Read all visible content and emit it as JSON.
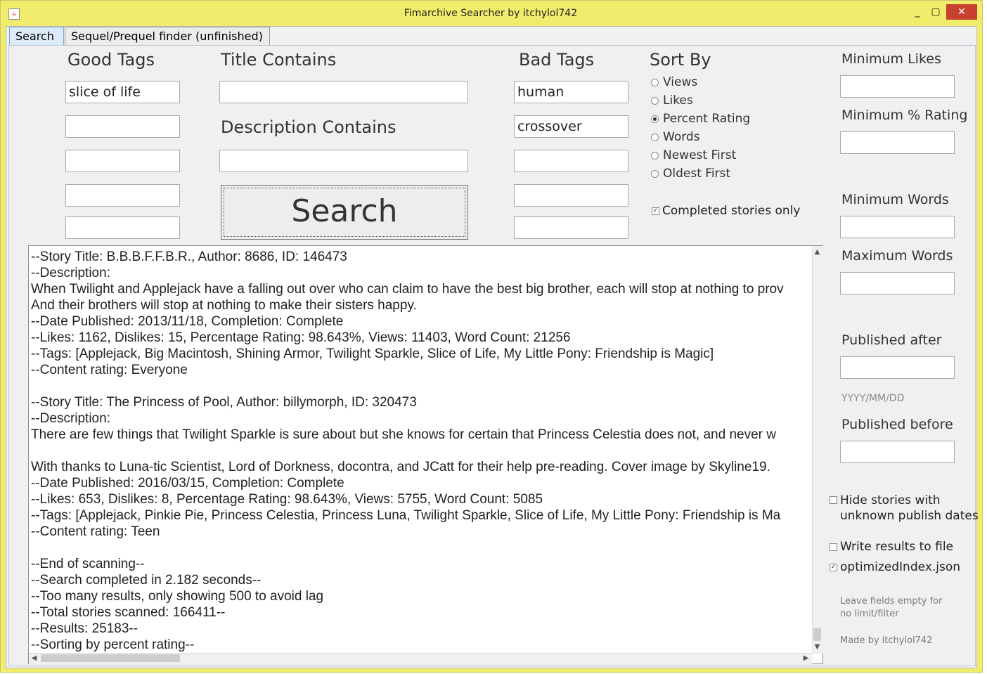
{
  "window": {
    "title": "Fimarchive Searcher by itchylol742",
    "minimize": "_",
    "maximize": "▢",
    "close": "✕"
  },
  "tabs": [
    {
      "label": "Search",
      "active": true
    },
    {
      "label": "Sequel/Prequel finder (unfinished)",
      "active": false
    }
  ],
  "good_tags": {
    "header": "Good Tags",
    "values": [
      "slice of life",
      "",
      "",
      "",
      ""
    ]
  },
  "title_contains": {
    "header": "Title Contains",
    "value": ""
  },
  "description_contains": {
    "header": "Description Contains",
    "value": ""
  },
  "search_button": "Search",
  "bad_tags": {
    "header": "Bad Tags",
    "values": [
      "human",
      "crossover",
      "",
      "",
      ""
    ]
  },
  "sort_by": {
    "header": "Sort By",
    "options": [
      "Views",
      "Likes",
      "Percent Rating",
      "Words",
      "Newest First",
      "Oldest First"
    ],
    "selected": "Percent Rating"
  },
  "completed_only": {
    "label": "Completed stories only",
    "checked": true
  },
  "filters": {
    "min_likes": {
      "label": "Minimum Likes",
      "value": ""
    },
    "min_rating": {
      "label": "Minimum % Rating",
      "value": ""
    },
    "min_words": {
      "label": "Minimum Words",
      "value": ""
    },
    "max_words": {
      "label": "Maximum Words",
      "value": ""
    },
    "published_after": {
      "label": "Published after",
      "value": ""
    },
    "date_format_hint": "YYYY/MM/DD",
    "published_before": {
      "label": "Published before",
      "value": ""
    }
  },
  "options": {
    "hide_unknown_dates": {
      "label_line1": "Hide stories with",
      "label_line2": "unknown publish dates",
      "checked": false
    },
    "write_to_file": {
      "label": "Write results to file",
      "checked": false
    },
    "optimized_index": {
      "label": "optimizedIndex.json",
      "checked": true
    }
  },
  "footer": {
    "hint_line1": "Leave fields empty for",
    "hint_line2": "no limit/filter",
    "credit": "Made by itchylol742"
  },
  "output_lines": [
    "--Story Title: B.B.B.F.F.B.R., Author: 8686, ID: 146473",
    "--Description:",
    "When Twilight and Applejack have a falling out over who can claim to have the best big brother, each will stop at nothing to prov",
    "And their brothers will stop at nothing to make their sisters happy.",
    "--Date Published: 2013/11/18, Completion: Complete",
    "--Likes: 1162, Dislikes: 15, Percentage Rating: 98.643%, Views: 11403, Word Count: 21256",
    "--Tags: [Applejack, Big Macintosh, Shining Armor, Twilight Sparkle, Slice of Life, My Little Pony: Friendship is Magic]",
    "--Content rating: Everyone",
    "",
    "--Story Title: The Princess of Pool, Author: billymorph, ID: 320473",
    "--Description:",
    "There are few things that Twilight Sparkle is sure about but she knows for certain that Princess Celestia does not, and never w",
    "",
    "With thanks to Luna-tic Scientist, Lord of Dorkness, docontra, and JCatt for their help pre-reading. Cover image by Skyline19.",
    "--Date Published: 2016/03/15, Completion: Complete",
    "--Likes: 653, Dislikes: 8, Percentage Rating: 98.643%, Views: 5755, Word Count: 5085",
    "--Tags: [Applejack, Pinkie Pie, Princess Celestia, Princess Luna, Twilight Sparkle, Slice of Life, My Little Pony: Friendship is Ma",
    "--Content rating: Teen",
    "",
    "--End of scanning--",
    "--Search completed in 2.182 seconds--",
    "--Too many results, only showing 500 to avoid lag",
    "--Total stories scanned: 166411--",
    "--Results: 25183--",
    "--Sorting by percent rating--"
  ]
}
